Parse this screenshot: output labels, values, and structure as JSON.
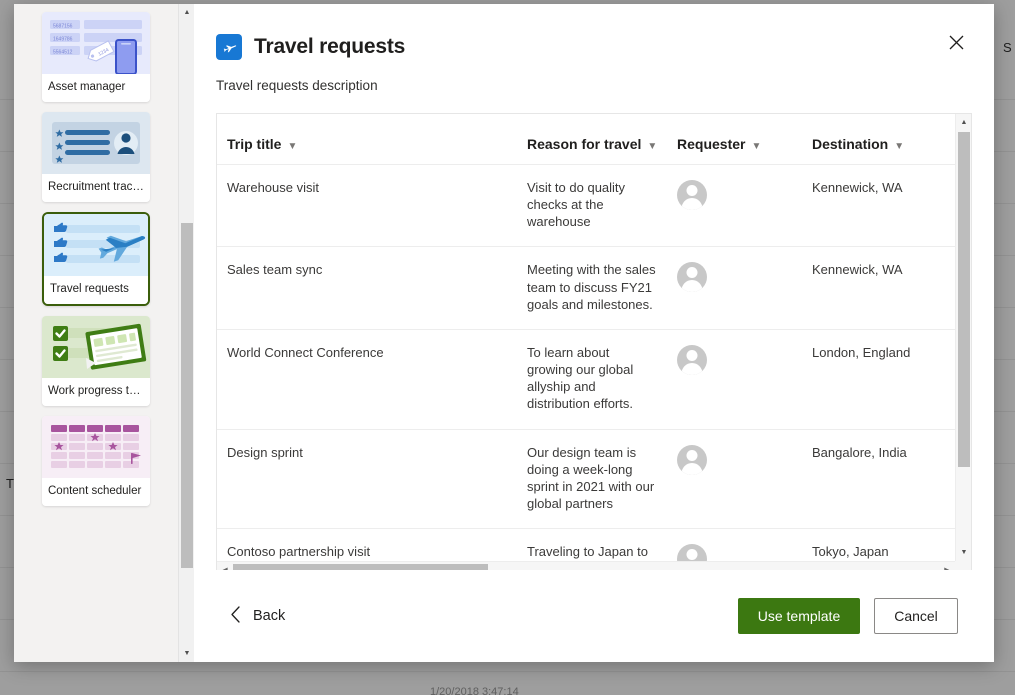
{
  "background": {
    "right_text": "S",
    "left_text": "T",
    "bottom_text": "1/20/2018 3:47:14"
  },
  "dialog": {
    "title": "Travel requests",
    "description": "Travel requests description",
    "app_icon": "airplane-icon",
    "close_icon": "close-icon",
    "accent_color": "#1878d4"
  },
  "rail": {
    "templates": [
      {
        "label": "Asset manager",
        "thumb": "asset-manager-thumb",
        "selected": false
      },
      {
        "label": "Recruitment tracker",
        "thumb": "recruitment-tracker-thumb",
        "selected": false
      },
      {
        "label": "Travel requests",
        "thumb": "travel-requests-thumb",
        "selected": true
      },
      {
        "label": "Work progress tra...",
        "thumb": "work-progress-tracker-thumb",
        "selected": false
      },
      {
        "label": "Content scheduler",
        "thumb": "content-scheduler-thumb",
        "selected": false
      }
    ],
    "scroll_up_icon": "triangle-up-icon",
    "scroll_down_icon": "triangle-down-icon"
  },
  "table": {
    "columns": [
      {
        "label": "Trip title",
        "sort_icon": "chevron-down-icon"
      },
      {
        "label": "Reason for travel",
        "sort_icon": "chevron-down-icon"
      },
      {
        "label": "Requester",
        "sort_icon": "chevron-down-icon"
      },
      {
        "label": "Destination",
        "sort_icon": "chevron-down-icon"
      }
    ],
    "rows": [
      {
        "trip_title": "Warehouse visit",
        "reason": "Visit to do quality checks at the warehouse",
        "requester_avatar": "person-avatar",
        "destination": "Kennewick, WA"
      },
      {
        "trip_title": "Sales team sync",
        "reason": "Meeting with the sales team to discuss FY21 goals and milestones.",
        "requester_avatar": "person-avatar",
        "destination": "Kennewick, WA"
      },
      {
        "trip_title": "World Connect Conference",
        "reason": "To learn about growing our global allyship and distribution efforts.",
        "requester_avatar": "person-avatar",
        "destination": "London, England"
      },
      {
        "trip_title": "Design sprint",
        "reason": "Our design team is doing a week-long sprint in 2021 with our global partners",
        "requester_avatar": "person-avatar",
        "destination": "Bangalore, India"
      },
      {
        "trip_title": "Contoso partnership visit",
        "reason": "Traveling to Japan to strengthen our partnership with Contoso and make negotiations with manufacturing.",
        "requester_avatar": "person-avatar",
        "destination": "Tokyo, Japan"
      }
    ],
    "hscroll_left_icon": "triangle-left-icon",
    "hscroll_right_icon": "triangle-right-icon",
    "vscroll_up_icon": "triangle-up-icon",
    "vscroll_down_icon": "triangle-down-icon"
  },
  "footer": {
    "back_label": "Back",
    "back_icon": "chevron-left-icon",
    "use_template_label": "Use template",
    "cancel_label": "Cancel",
    "primary_color": "#3c7811"
  }
}
